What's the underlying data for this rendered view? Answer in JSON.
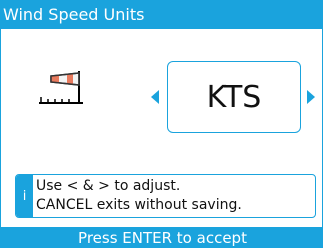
{
  "title": "Wind Speed Units",
  "icon": "windsock-icon",
  "selector": {
    "value": "KTS",
    "left_arrow_icon": "triangle-left-icon",
    "right_arrow_icon": "triangle-right-icon"
  },
  "hint": {
    "info_label": "i",
    "lines": [
      "Use < & > to adjust.",
      "CANCEL exits without saving."
    ]
  },
  "footer": "Press ENTER to accept",
  "colors": {
    "accent": "#1aa3dd",
    "windsock": "#e87a5d",
    "background": "#ffffff"
  }
}
